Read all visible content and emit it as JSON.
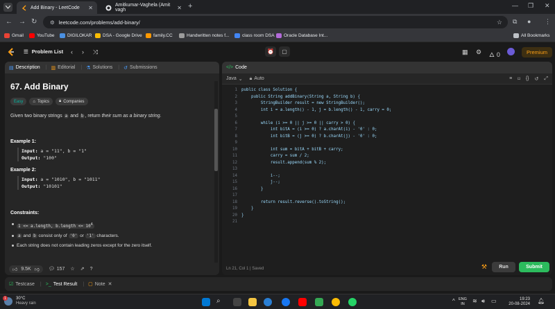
{
  "browser": {
    "tabs": [
      {
        "title": "Add Binary - LeetCode",
        "active": true
      },
      {
        "title": "Amitkumar-Vaghela (Amit vagh",
        "active": false
      }
    ],
    "url": "leetcode.com/problems/add-binary/",
    "bookmarks": [
      {
        "label": "Gmail",
        "color": "#ea4335"
      },
      {
        "label": "YouTube",
        "color": "#ff0000"
      },
      {
        "label": "DIGILOKAR",
        "color": "#4a90e2"
      },
      {
        "label": "DSA - Google Drive",
        "color": "#fbbc04"
      },
      {
        "label": "family.CC",
        "color": "#ff9800"
      },
      {
        "label": "Handwritten notes f...",
        "color": "#9c9c9c"
      },
      {
        "label": "class room DSA",
        "color": "#4285f4"
      },
      {
        "label": "Oracle Database Int...",
        "color": "#b36ad9"
      }
    ],
    "all_bookmarks": "All Bookmarks"
  },
  "lc": {
    "problem_list": "Problem List",
    "fire_count": "0",
    "premium": "Premium"
  },
  "left": {
    "tabs": [
      "Description",
      "Editorial",
      "Solutions",
      "Submissions"
    ],
    "title": "67. Add Binary",
    "tags": [
      "Easy",
      "Topics",
      "Companies"
    ],
    "statement": {
      "p1": "Given two binary strings ",
      "a": "a",
      "p2": " and ",
      "b": "b",
      "p3": ", return ",
      "em": "their sum as a binary string",
      "p4": "."
    },
    "examples": [
      {
        "title": "Example 1:",
        "input": "a = \"11\", b = \"1\"",
        "output": "\"100\""
      },
      {
        "title": "Example 2:",
        "input": "a = \"1010\", b = \"1011\"",
        "output": "\"10101\""
      }
    ],
    "input_label": "Input:",
    "output_label": "Output:",
    "constraints_title": "Constraints:",
    "constraints": {
      "c1": "1 <= a.length, b.length <= 10",
      "c1_sup": "4",
      "c2_a": "a",
      "c2_and": " and ",
      "c2_b": "b",
      "c2_mid": " consist only of ",
      "c2_0": "'0'",
      "c2_or": " or ",
      "c2_1": "'1'",
      "c2_end": " characters.",
      "c3": "Each string does not contain leading zeros except for the zero itself."
    },
    "likes": "9.5K",
    "comments": "157"
  },
  "editor": {
    "title": "Code",
    "language": "Java",
    "auto": "Auto",
    "lines": [
      "public class Solution {",
      "    public String addBinary(String a, String b) {",
      "        StringBuilder result = new StringBuilder();",
      "        int i = a.length() - 1, j = b.length() - 1, carry = 0;",
      "",
      "        while (i >= 0 || j >= 0 || carry > 0) {",
      "            int bitA = (i >= 0) ? a.charAt(i) - '0' : 0;",
      "            int bitB = (j >= 0) ? b.charAt(j) - '0' : 0;",
      "",
      "            int sum = bitA + bitB + carry;",
      "            carry = sum / 2;",
      "            result.append(sum % 2);",
      "",
      "            i--;",
      "            j--;",
      "        }",
      "",
      "        return result.reverse().toString();",
      "    }",
      "}",
      ""
    ],
    "status": "Ln 21, Col 1",
    "saved": "Saved",
    "run": "Run",
    "submit": "Submit"
  },
  "bottom": {
    "tabs": [
      "Testcase",
      "Test Result",
      "Note"
    ]
  },
  "taskbar": {
    "temp": "30°C",
    "weather": "Heavy rain",
    "lang1": "ENG",
    "lang2": "IN",
    "time": "19:23",
    "date": "20-08-2024",
    "badge": "1"
  }
}
